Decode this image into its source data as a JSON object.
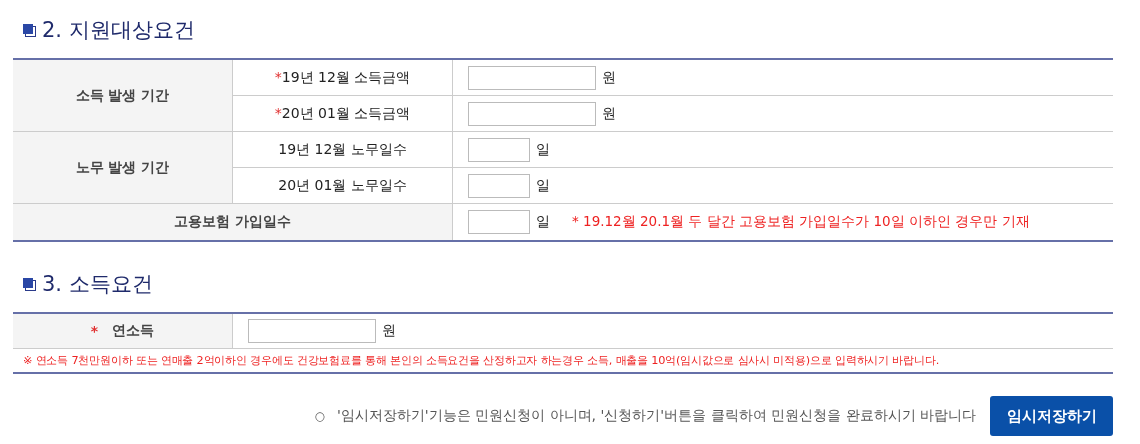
{
  "section_2": {
    "title": "2. 지원대상요건",
    "groups": [
      {
        "label": "소득 발생 기간",
        "rows": [
          {
            "mark": "*",
            "label": "19년 12월 소득금액",
            "kind": "amount",
            "unit": "원"
          },
          {
            "mark": "*",
            "label": "20년 01월 소득금액",
            "kind": "amount",
            "unit": "원"
          }
        ]
      },
      {
        "label": "노무 발생 기간",
        "rows": [
          {
            "label": "19년 12월 노무일수",
            "kind": "days",
            "unit": "일"
          },
          {
            "label": "20년 01월 노무일수",
            "kind": "days",
            "unit": "일"
          }
        ]
      }
    ],
    "insurance_row": {
      "label": "고용보험 가입일수",
      "kind": "days",
      "unit": "일",
      "note": "* 19.12월 20.1월 두 달간 고용보험 가입일수가 10일 이하인 경우만 기재"
    }
  },
  "section_3": {
    "title": "3. 소득요건",
    "row": {
      "mark": "*",
      "label": "연소득",
      "kind": "amount",
      "unit": "원"
    },
    "note": "※ 연소득 7천만원이하 또는 연매출 2억이하인 경우에도 건강보험료를 통해 본인의 소득요건을 산정하고자 하는경우 소득, 매출을 10억(임시값으로 심사시 미적용)으로 입력하시기 바랍니다."
  },
  "footer": {
    "bullet": "○",
    "text": "'임시저장하기'기능은 민원신청이 아니며, '신청하기'버튼을 클릭하여 민원신청을 완료하시기 바랍니다",
    "button": "임시저장하기"
  }
}
